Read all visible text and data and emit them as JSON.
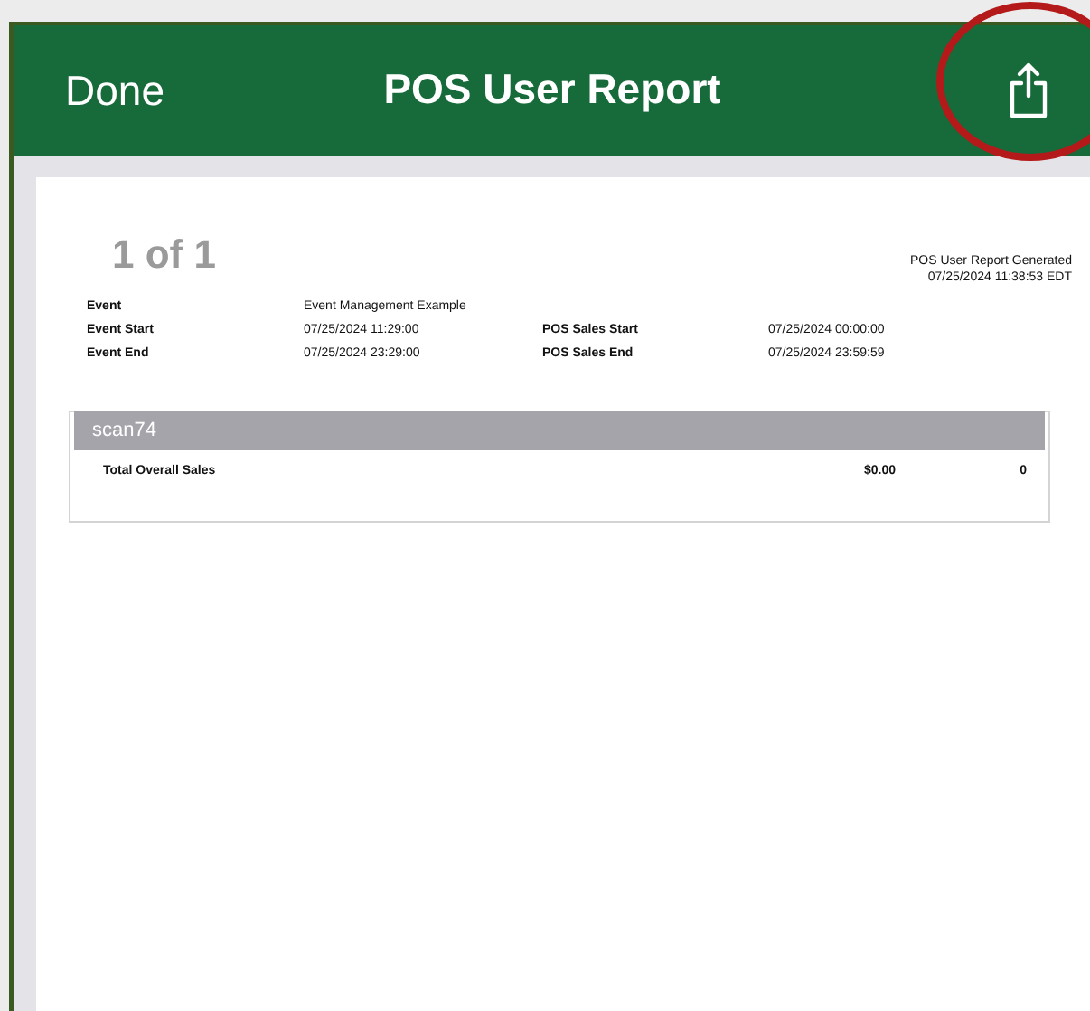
{
  "nav_bar": {
    "left_button": "Done",
    "title": "POS User Report"
  },
  "report": {
    "page_indicator": "1 of 1",
    "generated_label": "POS User Report Generated",
    "generated_time": "07/25/2024 11:38:53 EDT",
    "details": [
      {
        "label": "Event",
        "value": "Event Management Example"
      },
      {
        "label": "Event Start",
        "value": "07/25/2024 11:29:00",
        "label_2": "POS Sales Start",
        "value_2": "07/25/2024 00:00:00"
      },
      {
        "label": "Event End",
        "value": "07/25/2024 23:29:00",
        "label_2": "POS Sales End",
        "value_2": "07/25/2024 23:59:59"
      }
    ],
    "user_section": {
      "header": "scan74",
      "rows": [
        {
          "label": "Total Overall Sales",
          "amount": "$0.00",
          "count": "0"
        }
      ]
    }
  }
}
